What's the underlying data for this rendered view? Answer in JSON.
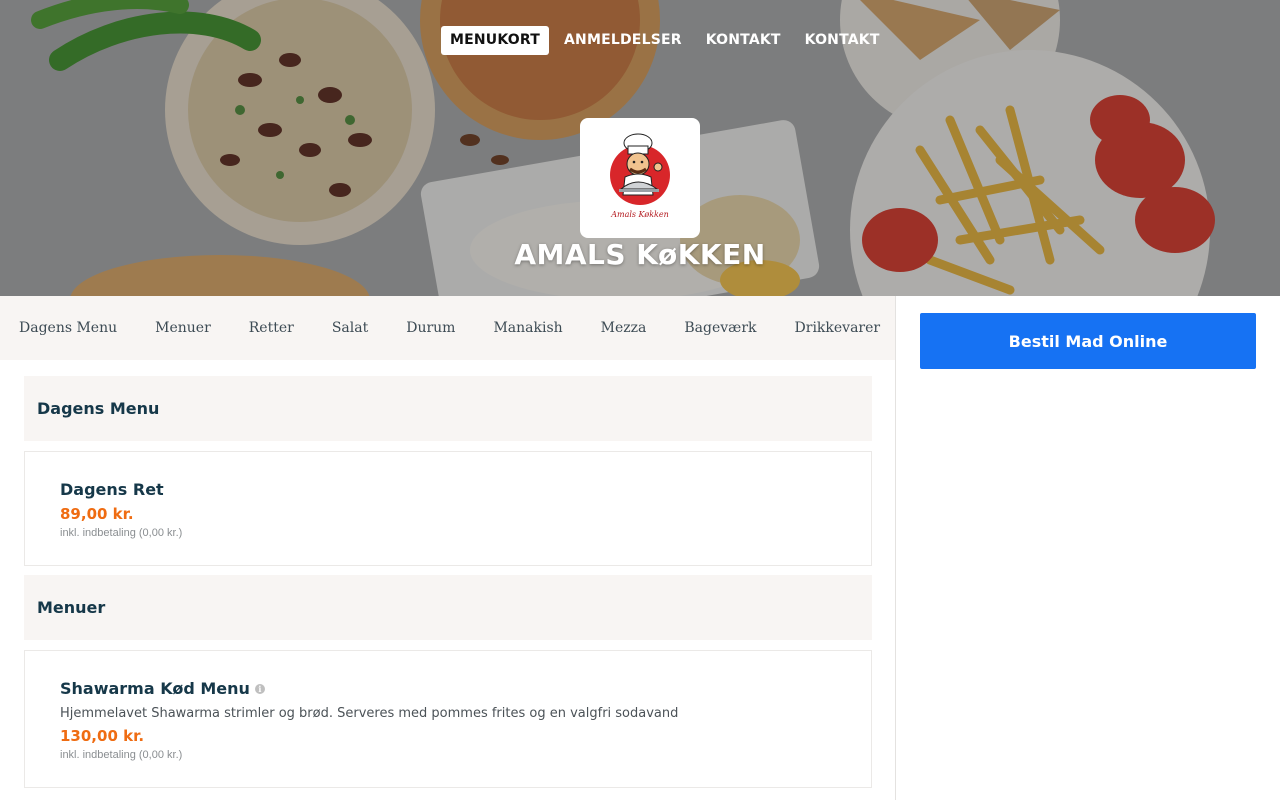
{
  "nav": {
    "items": [
      {
        "label": "MENUKORT",
        "active": true
      },
      {
        "label": "ANMELDELSER",
        "active": false
      },
      {
        "label": "KONTAKT",
        "active": false
      },
      {
        "label": "KONTAKT",
        "active": false
      }
    ]
  },
  "restaurant": {
    "name": "AMALS KøKKEN",
    "logo_script": "Amals Køkken",
    "logo_icon": "chef-logo-icon"
  },
  "categories": [
    "Dagens Menu",
    "Menuer",
    "Retter",
    "Salat",
    "Durum",
    "Manakish",
    "Mezza",
    "Bageværk",
    "Drikkevarer"
  ],
  "sections": [
    {
      "title": "Dagens Menu",
      "items": [
        {
          "name": "Dagens Ret",
          "description": "",
          "price": "89,00 kr.",
          "note": "inkl. indbetaling (0,00 kr.)",
          "has_info": false
        }
      ]
    },
    {
      "title": "Menuer",
      "items": [
        {
          "name": "Shawarma Kød Menu",
          "description": "Hjemmelavet Shawarma strimler og brød. Serveres med pommes frites og en valgfri sodavand",
          "price": "130,00 kr.",
          "note": "inkl. indbetaling (0,00 kr.)",
          "has_info": true
        }
      ]
    }
  ],
  "order": {
    "button_label": "Bestil Mad Online"
  },
  "colors": {
    "accent_blue": "#1672f3",
    "price_orange": "#ef6c12",
    "heading_navy": "#163849",
    "section_bg": "#f8f5f3"
  }
}
